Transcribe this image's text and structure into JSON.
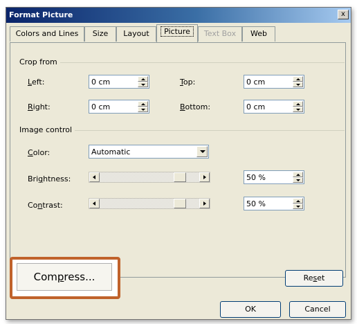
{
  "window": {
    "title": "Format Picture",
    "close_glyph": "x"
  },
  "tabs": [
    {
      "label": "Colors and Lines",
      "state": "normal"
    },
    {
      "label": "Size",
      "state": "normal"
    },
    {
      "label": "Layout",
      "state": "normal"
    },
    {
      "label": "Picture",
      "state": "active"
    },
    {
      "label": "Text Box",
      "state": "disabled"
    },
    {
      "label": "Web",
      "state": "normal"
    }
  ],
  "crop": {
    "group_label": "Crop from",
    "left": {
      "label_pre": "",
      "label_mnemonic": "L",
      "label_post": "eft:",
      "value": "0 cm"
    },
    "right": {
      "label_pre": "",
      "label_mnemonic": "R",
      "label_post": "ight:",
      "value": "0 cm"
    },
    "top": {
      "label_pre": "",
      "label_mnemonic": "T",
      "label_post": "op:",
      "value": "0 cm"
    },
    "bottom": {
      "label_pre": "",
      "label_mnemonic": "B",
      "label_post": "ottom:",
      "value": "0 cm"
    }
  },
  "image_control": {
    "group_label": "Image control",
    "color": {
      "label_pre": "",
      "label_mnemonic": "C",
      "label_post": "olor:",
      "value": "Automatic"
    },
    "brightness": {
      "label_pre": "Bri",
      "label_mnemonic": "g",
      "label_post": "htness:",
      "value": "50 %",
      "level": 0.5
    },
    "contrast": {
      "label_pre": "Co",
      "label_mnemonic": "n",
      "label_post": "trast:",
      "value": "50 %",
      "level": 0.5
    }
  },
  "buttons": {
    "compress_pre": "Com",
    "compress_mnemonic": "p",
    "compress_post": "ress...",
    "reset_pre": "Re",
    "reset_mnemonic": "s",
    "reset_post": "et",
    "ok": "OK",
    "cancel": "Cancel"
  },
  "colors": {
    "highlight": "#c0622b",
    "titlebar_start": "#0a246a"
  }
}
